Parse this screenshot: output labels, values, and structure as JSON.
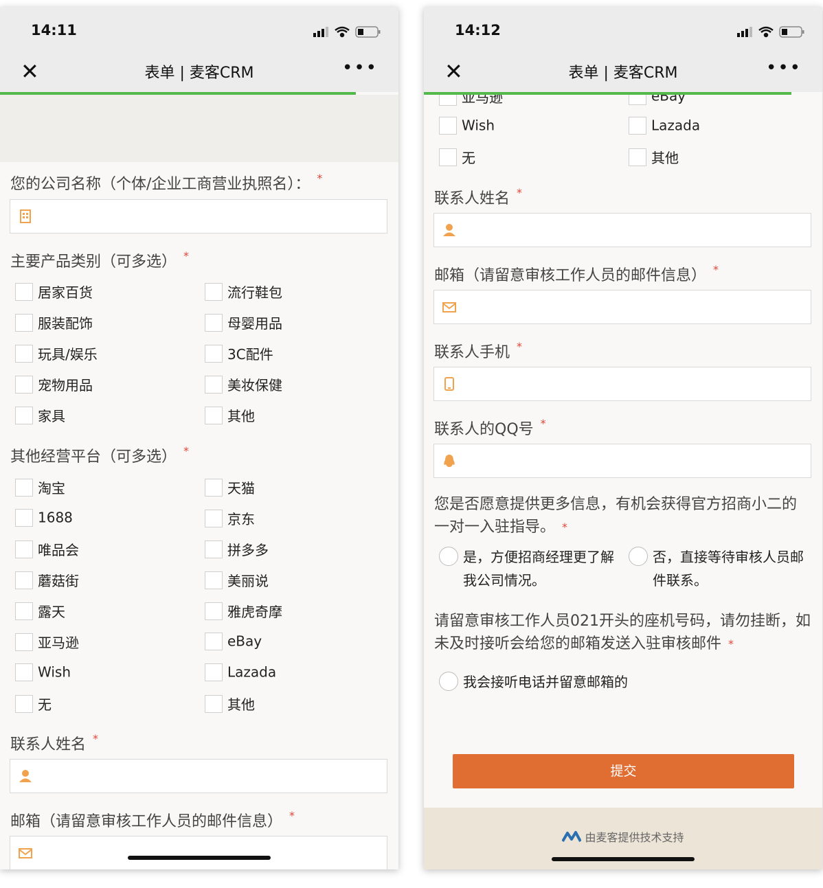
{
  "left": {
    "time": "14:11",
    "title": "表单 | 麦客CRM",
    "company_label": "您的公司名称（个体/企业工商营业执照名）：",
    "product_label": "主要产品类别（可多选）",
    "products": [
      "居家百货",
      "流行鞋包",
      "服装配饰",
      "母婴用品",
      "玩具/娱乐",
      "3C配件",
      "宠物用品",
      "美妆保健",
      "家具",
      "其他"
    ],
    "platform_label": "其他经营平台（可多选）",
    "platforms": [
      "淘宝",
      "天猫",
      "1688",
      "京东",
      "唯品会",
      "拼多多",
      "蘑菇街",
      "美丽说",
      "露天",
      "雅虎奇摩",
      "亚马逊",
      "eBay",
      "Wish",
      "Lazada",
      "无",
      "其他"
    ],
    "contact_name_label": "联系人姓名",
    "email_label": "邮箱（请留意审核工作人员的邮件信息）"
  },
  "right": {
    "time": "14:12",
    "title": "表单 | 麦客CRM",
    "partial_platforms": [
      "亚马逊",
      "eBay"
    ],
    "platforms_tail": [
      "Wish",
      "Lazada",
      "无",
      "其他"
    ],
    "contact_name_label": "联系人姓名",
    "email_label": "邮箱（请留意审核工作人员的邮件信息）",
    "phone_label": "联系人手机",
    "qq_label": "联系人的QQ号",
    "more_info_question": "您是否愿意提供更多信息，有机会获得官方招商小二的一对一入驻指导。",
    "more_info_options": [
      "是，方便招商经理更了解我公司情况。",
      "否，直接等待审核人员邮件联系。"
    ],
    "phone_notice": "请留意审核工作人员021开头的座机号码，请勿挂断，如未及时接听会给您的邮箱发送入驻审核邮件",
    "phone_notice_option": "我会接听电话并留意邮箱的",
    "submit_label": "提交",
    "footer_text": "由麦客提供技术支持"
  },
  "required_mark": "*",
  "close_glyph": "✕",
  "more_glyph": "•••",
  "colors": {
    "progress": "#53b94b",
    "submit": "#e06d32",
    "required": "#e0463b",
    "icon": "#f0a24e"
  }
}
